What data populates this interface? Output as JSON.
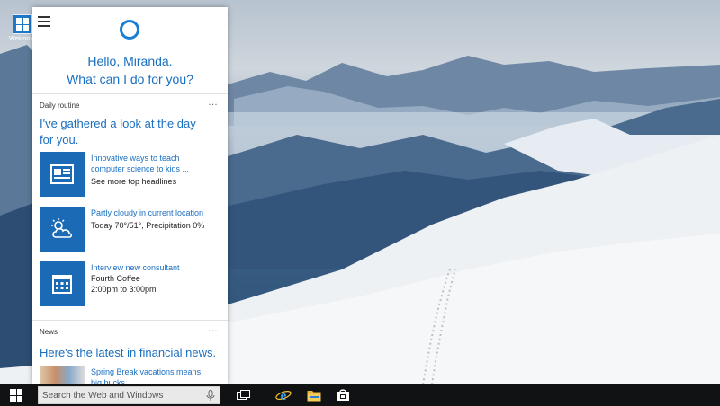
{
  "desktop": {
    "icon_caption": "Welcome"
  },
  "cortana": {
    "greeting_line1": "Hello, Miranda.",
    "greeting_line2": "What can I do for you?",
    "daily_routine": {
      "header": "Daily routine",
      "more": "…",
      "title_line1": "I've gathered a look at the day",
      "title_line2": "for you.",
      "cards": [
        {
          "icon": "newspaper-icon",
          "line1": "Innovative ways to teach",
          "line2": "computer science to kids ...",
          "line3": "See more top headlines"
        },
        {
          "icon": "partly-cloudy-icon",
          "line1": "Partly cloudy in current location",
          "line2": "Today 70°/51°, Precipitation 0%"
        },
        {
          "icon": "calendar-icon",
          "line1": "Interview new consultant",
          "line2": "Fourth Coffee",
          "line3": "2:00pm to 3:00pm"
        }
      ]
    },
    "news": {
      "header": "News",
      "more": "…",
      "title": "Here's the latest in financial news.",
      "item": {
        "line1": "Spring Break vacations means",
        "line2": "big bucks"
      }
    }
  },
  "taskbar": {
    "search_placeholder": "Search the Web and Windows",
    "icons": [
      "start-icon",
      "microphone-icon",
      "task-view-icon",
      "internet-explorer-icon",
      "file-explorer-icon",
      "store-icon"
    ]
  },
  "colors": {
    "accent": "#1a6fc0",
    "tile": "#1a6ab5",
    "taskbar": "#101214"
  }
}
